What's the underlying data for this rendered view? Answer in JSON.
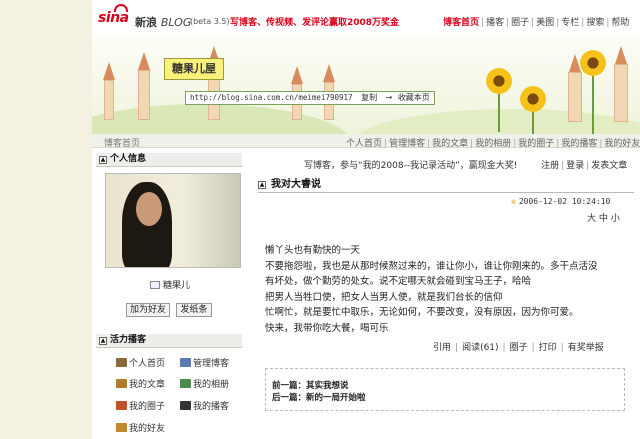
{
  "header": {
    "logo": "sina",
    "brand_cn": "新浪",
    "brand_en": "BLOG",
    "version": "(beta 3.5)",
    "promo": "写博客、传视频、发评论赢取2008万奖金",
    "nav": [
      {
        "label": "博客首页",
        "active": true
      },
      {
        "label": "播客"
      },
      {
        "label": "圈子"
      },
      {
        "label": "美图"
      },
      {
        "label": "专栏"
      },
      {
        "label": "搜索"
      },
      {
        "label": "帮助"
      }
    ]
  },
  "banner": {
    "blog_title": "糖果儿屋",
    "url": "http://blog.sina.com.cn/meimei790917",
    "copy_label": "复制",
    "bookmark_label": "收藏本页"
  },
  "subnav": {
    "breadcrumb": "博客首页",
    "links": [
      "个人首页",
      "管理博客",
      "我的文章",
      "我的相册",
      "我的圈子",
      "我的播客",
      "我的好友"
    ]
  },
  "sidebar": {
    "profile_title": "个人信息",
    "username": "糖果儿",
    "add_friend_label": "加为好友",
    "send_message_label": "发纸条",
    "active_title": "活力播客",
    "menu": [
      {
        "label": "个人首页",
        "icon": "home-icon",
        "color": "#8a6a3a"
      },
      {
        "label": "管理博客",
        "icon": "manage-icon",
        "color": "#5a7ab0"
      },
      {
        "label": "我的文章",
        "icon": "article-icon",
        "color": "#b07a2a"
      },
      {
        "label": "我的相册",
        "icon": "album-icon",
        "color": "#4a8a4a"
      },
      {
        "label": "我的圈子",
        "icon": "circle-icon",
        "color": "#c0502a"
      },
      {
        "label": "我的播客",
        "icon": "video-icon",
        "color": "#333333"
      },
      {
        "label": "我的好友",
        "icon": "friends-icon",
        "color": "#c08a2a"
      }
    ]
  },
  "main": {
    "post_prompt": "写博客，参与“我的2008--我记录活动”，赢现金大奖!",
    "register_label": "注册",
    "login_label": "登录",
    "publish_label": "发表文章",
    "article_title": "我对大睿说",
    "date": "2006-12-02 10:24:10",
    "size_big": "大",
    "size_mid": "中",
    "size_small": "小",
    "body_lines": [
      "懒丫头也有勤快的一天",
      "不要拖怨啦，我也是从那时候熬过来的，谁让你小，谁让你刚来的。多干点活没",
      "有坏处，做个勤劳的处女。说不定哪天就会碰到宝马王子，哈哈",
      "把男人当牲口使，把女人当男人使，就是我们台长的信仰",
      "忙啊忙，就是要忙中取乐，无论如何，不要改变，没有原因，因为你可爱。",
      "快来，我带你吃大餐，喝可乐"
    ],
    "actions": {
      "quote": "引用",
      "read": "阅读(61)",
      "circle": "圈子",
      "print": "打印",
      "report": "有奖举报"
    },
    "prev_label": "前一篇：其实我想说",
    "next_label": "后一篇：新的一局开始啦"
  },
  "colors": {
    "brand_red": "#d8001a",
    "page_bg": "#f4f1e3",
    "section_bg": "#eceeea"
  }
}
